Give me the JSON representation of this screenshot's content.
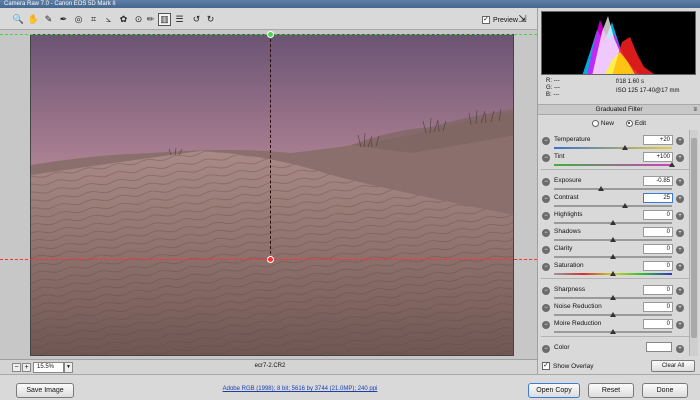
{
  "window": {
    "title": "Camera Raw 7.0 - Canon EOS 5D Mark II"
  },
  "toolbar": {
    "tools": [
      {
        "name": "zoom-tool",
        "glyph": "🔍"
      },
      {
        "name": "hand-tool",
        "glyph": "✋"
      },
      {
        "name": "white-balance-tool",
        "glyph": "✎"
      },
      {
        "name": "color-sampler-tool",
        "glyph": "✒"
      },
      {
        "name": "targeted-adjustment-tool",
        "glyph": "◎"
      },
      {
        "name": "crop-tool",
        "glyph": "⌗"
      },
      {
        "name": "straighten-tool",
        "glyph": "⦣"
      },
      {
        "name": "spot-removal-tool",
        "glyph": "✿"
      },
      {
        "name": "red-eye-tool",
        "glyph": "⊙"
      },
      {
        "name": "adjustment-brush-tool",
        "glyph": "✏"
      },
      {
        "name": "graduated-filter-tool",
        "glyph": "▥"
      },
      {
        "name": "preferences-tool",
        "glyph": "☰"
      },
      {
        "name": "rotate-ccw-tool",
        "glyph": "↺"
      },
      {
        "name": "rotate-cw-tool",
        "glyph": "↻"
      }
    ],
    "preview_label": "Preview",
    "preview_check": "✓",
    "open_window_glyph": "⇲"
  },
  "status": {
    "zoom_minus": "−",
    "zoom_plus": "+",
    "zoom_value": "15.5%",
    "zoom_dropdown": "▼",
    "filename": "ecr7-2.CR2"
  },
  "readout": {
    "r": "R:   ---",
    "g": "G:   ---",
    "b": "B:   ---",
    "aperture_shutter": "f/18   1.60 s",
    "iso_lens": "ISO 125   17-40@17 mm"
  },
  "panel": {
    "title": "Graduated Filter",
    "menu_glyph": "≡",
    "mode_new": "New",
    "mode_edit": "Edit",
    "sliders": [
      {
        "label": "Temperature",
        "value": "+20",
        "position": 0.6,
        "group": 0
      },
      {
        "label": "Tint",
        "value": "+100",
        "position": 1.0,
        "group": 0
      },
      {
        "label": "Exposure",
        "value": "-0.85",
        "position": 0.4,
        "group": 1
      },
      {
        "label": "Contrast",
        "value": "25",
        "position": 0.6,
        "group": 1,
        "focus": true
      },
      {
        "label": "Highlights",
        "value": "0",
        "position": 0.5,
        "group": 1
      },
      {
        "label": "Shadows",
        "value": "0",
        "position": 0.5,
        "group": 1
      },
      {
        "label": "Clarity",
        "value": "0",
        "position": 0.5,
        "group": 1
      },
      {
        "label": "Saturation",
        "value": "0",
        "position": 0.5,
        "group": 1
      },
      {
        "label": "Sharpness",
        "value": "0",
        "position": 0.5,
        "group": 2
      },
      {
        "label": "Noise Reduction",
        "value": "0",
        "position": 0.5,
        "group": 2
      },
      {
        "label": "Moire Reduction",
        "value": "0",
        "position": 0.5,
        "group": 2
      },
      {
        "label": "Color",
        "value": "",
        "position": null,
        "group": 3
      }
    ],
    "minus_glyph": "−",
    "plus_glyph": "+",
    "show_overlay_label": "Show Overlay",
    "show_overlay_check": "✓",
    "clear_all_label": "Clear All"
  },
  "footer": {
    "save_image": "Save Image",
    "workflow": "Adobe RGB (1998); 8 bit; 5616 by 3744 (21.0MP); 240 ppi",
    "open_copy": "Open Copy",
    "reset": "Reset",
    "done": "Done"
  },
  "colors": {
    "guide_green": "#4fd14f",
    "guide_red": "#ff3030",
    "accent": "#3b7ad6"
  }
}
